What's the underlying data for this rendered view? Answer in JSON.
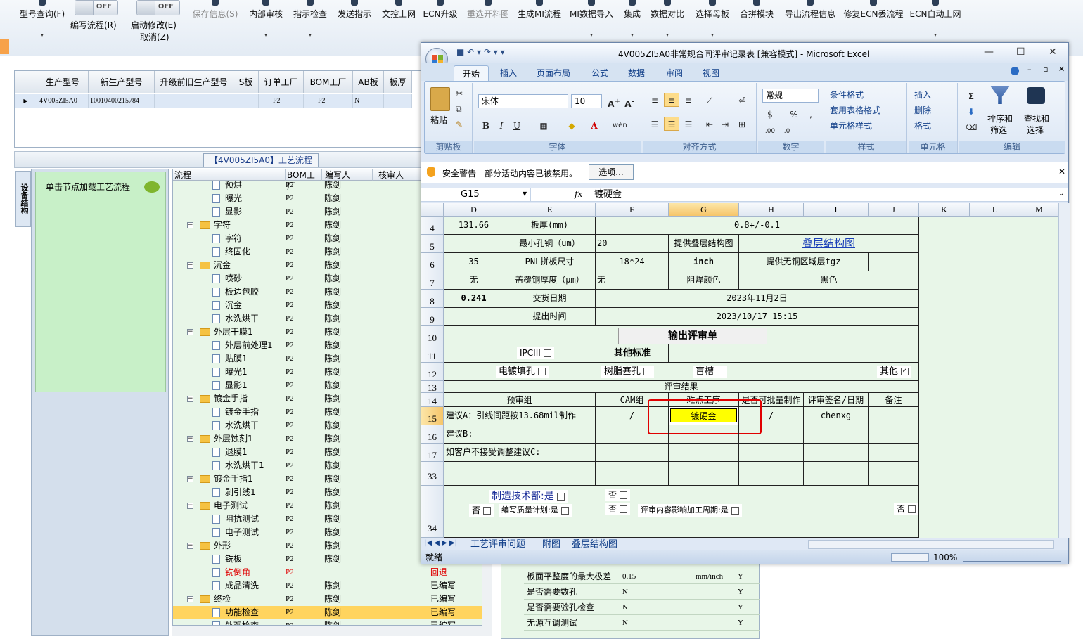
{
  "toolbar": {
    "items": [
      {
        "label": "型号查询(F)",
        "arrow": "▾"
      },
      {
        "label": "保存信息(S)",
        "disabled": true
      },
      {
        "label": "内部审核",
        "arrow": "▾"
      },
      {
        "label": "指示检查",
        "arrow": "▾"
      },
      {
        "label": "发送指示"
      },
      {
        "label": "文控上网"
      },
      {
        "label": "ECN升级"
      },
      {
        "label": "重选开料图",
        "disabled": true
      },
      {
        "label": "生成MI流程"
      },
      {
        "label": "MI数据导入",
        "arrow": "▾"
      },
      {
        "label": "集成",
        "arrow": "▾"
      },
      {
        "label": "数据对比",
        "arrow": "▾"
      },
      {
        "label": "选择母板",
        "arrow": "▾"
      },
      {
        "label": "合拼模块"
      },
      {
        "label": "导出流程信息"
      },
      {
        "label": "修复ECN丢流程"
      },
      {
        "label": "ECN自动上网",
        "arrow": "▾"
      }
    ],
    "toggle1": {
      "state": "OFF",
      "label": "编写流程(R)"
    },
    "toggle2": {
      "state": "OFF",
      "label": "启动修改(E)",
      "sub": "取消(Z)"
    }
  },
  "grid1": {
    "headers": [
      "生产型号",
      "新生产型号",
      "升级前旧生产型号",
      "S板",
      "订单工厂",
      "BOM工厂",
      "AB板",
      "板厚"
    ],
    "row": [
      "4V005ZI5A0",
      "10010400215784",
      "",
      "",
      "P2",
      "P2",
      "N",
      ""
    ]
  },
  "process": {
    "title": "【4V005ZI5A0】工艺流程",
    "side_tab": "设备结构",
    "load_hint": "单击节点加载工艺流程",
    "headers": [
      "流程",
      "BOM工厂",
      "编写人",
      "核审人"
    ],
    "rows": [
      {
        "name": "预烘",
        "bom": "P2",
        "author": "陈剑",
        "level": 2,
        "status": ""
      },
      {
        "name": "曝光",
        "bom": "P2",
        "author": "陈剑",
        "level": 2,
        "status": ""
      },
      {
        "name": "显影",
        "bom": "P2",
        "author": "陈剑",
        "level": 2,
        "status": ""
      },
      {
        "name": "字符",
        "bom": "P2",
        "author": "陈剑",
        "level": 1,
        "status": ""
      },
      {
        "name": "字符",
        "bom": "P2",
        "author": "陈剑",
        "level": 2,
        "status": ""
      },
      {
        "name": "终固化",
        "bom": "P2",
        "author": "陈剑",
        "level": 2,
        "status": ""
      },
      {
        "name": "沉金",
        "bom": "P2",
        "author": "陈剑",
        "level": 1,
        "status": ""
      },
      {
        "name": "喷砂",
        "bom": "P2",
        "author": "陈剑",
        "level": 2,
        "status": ""
      },
      {
        "name": "板边包胶",
        "bom": "P2",
        "author": "陈剑",
        "level": 2,
        "status": ""
      },
      {
        "name": "沉金",
        "bom": "P2",
        "author": "陈剑",
        "level": 2,
        "status": ""
      },
      {
        "name": "水洗烘干",
        "bom": "P2",
        "author": "陈剑",
        "level": 2,
        "status": ""
      },
      {
        "name": "外层干膜1",
        "bom": "P2",
        "author": "陈剑",
        "level": 1,
        "status": ""
      },
      {
        "name": "外层前处理1",
        "bom": "P2",
        "author": "陈剑",
        "level": 2,
        "status": ""
      },
      {
        "name": "贴膜1",
        "bom": "P2",
        "author": "陈剑",
        "level": 2,
        "status": ""
      },
      {
        "name": "曝光1",
        "bom": "P2",
        "author": "陈剑",
        "level": 2,
        "status": ""
      },
      {
        "name": "显影1",
        "bom": "P2",
        "author": "陈剑",
        "level": 2,
        "status": ""
      },
      {
        "name": "镀金手指",
        "bom": "P2",
        "author": "陈剑",
        "level": 1,
        "status": ""
      },
      {
        "name": "镀金手指",
        "bom": "P2",
        "author": "陈剑",
        "level": 2,
        "status": ""
      },
      {
        "name": "水洗烘干",
        "bom": "P2",
        "author": "陈剑",
        "level": 2,
        "status": ""
      },
      {
        "name": "外层蚀刻1",
        "bom": "P2",
        "author": "陈剑",
        "level": 1,
        "status": ""
      },
      {
        "name": "退膜1",
        "bom": "P2",
        "author": "陈剑",
        "level": 2,
        "status": ""
      },
      {
        "name": "水洗烘干1",
        "bom": "P2",
        "author": "陈剑",
        "level": 2,
        "status": ""
      },
      {
        "name": "镀金手指1",
        "bom": "P2",
        "author": "陈剑",
        "level": 1,
        "status": ""
      },
      {
        "name": "剥引线1",
        "bom": "P2",
        "author": "陈剑",
        "level": 2,
        "status": ""
      },
      {
        "name": "电子测试",
        "bom": "P2",
        "author": "陈剑",
        "level": 1,
        "status": ""
      },
      {
        "name": "阻抗测试",
        "bom": "P2",
        "author": "陈剑",
        "level": 2,
        "status": ""
      },
      {
        "name": "电子测试",
        "bom": "P2",
        "author": "陈剑",
        "level": 2,
        "status": ""
      },
      {
        "name": "外形",
        "bom": "P2",
        "author": "陈剑",
        "level": 1,
        "status": ""
      },
      {
        "name": "铣板",
        "bom": "P2",
        "author": "陈剑",
        "level": 2,
        "status": ""
      },
      {
        "name": "铣倒角",
        "bom": "P2",
        "author": "",
        "level": 2,
        "status": "回退",
        "red": true
      },
      {
        "name": "成品清洗",
        "bom": "P2",
        "author": "陈剑",
        "level": 2,
        "status": "已编写"
      },
      {
        "name": "终检",
        "bom": "P2",
        "author": "陈剑",
        "level": 1,
        "status": "已编写"
      },
      {
        "name": "功能检查",
        "bom": "P2",
        "author": "陈剑",
        "level": 2,
        "status": "已编写",
        "selected": true
      },
      {
        "name": "外观检查",
        "bom": "P2",
        "author": "陈剑",
        "level": 2,
        "status": "已编写"
      }
    ]
  },
  "grid2": {
    "rows": [
      [
        "板面平整度的最大极差",
        "0.15",
        "mm/inch",
        "Y"
      ],
      [
        "是否需要数孔",
        "N",
        "",
        "Y"
      ],
      [
        "是否需要验孔检查",
        "N",
        "",
        "Y"
      ],
      [
        "无源互调测试",
        "N",
        "",
        "Y"
      ]
    ]
  },
  "excel": {
    "title": "4V005ZI5A0非常规合同评审记录表 [兼容模式] - Microsoft Excel",
    "tabs": [
      "开始",
      "插入",
      "页面布局",
      "公式",
      "数据",
      "审阅",
      "视图"
    ],
    "ribbon": {
      "clipboard": {
        "paste": "粘贴",
        "group": "剪贴板"
      },
      "font": {
        "name": "宋体",
        "size": "10",
        "group": "字体"
      },
      "align": {
        "group": "对齐方式"
      },
      "number": {
        "format": "常规",
        "group": "数字"
      },
      "styles": {
        "cond": "条件格式",
        "table": "套用表格格式",
        "cell": "单元格样式",
        "group": "样式"
      },
      "cells": {
        "insert": "插入",
        "delete": "删除",
        "format": "格式",
        "group": "单元格"
      },
      "edit": {
        "sort": "排序和",
        "sort2": "筛选",
        "find": "查找和",
        "find2": "选择",
        "group": "编辑"
      }
    },
    "security": {
      "label": "安全警告",
      "msg": "部分活动内容已被禁用。",
      "button": "选项..."
    },
    "namebox": "G15",
    "formula": "镀硬金",
    "columns": [
      "D",
      "E",
      "F",
      "G",
      "H",
      "I",
      "J",
      "K",
      "L",
      "M"
    ],
    "active_col": "G",
    "rownums": [
      "4",
      "5",
      "6",
      "7",
      "8",
      "9",
      "10",
      "11",
      "12",
      "13",
      "14",
      "15",
      "16",
      "17",
      "33",
      "34"
    ],
    "active_row": "15",
    "cells": {
      "r4": {
        "d": "131.66",
        "e": "板厚(mm)",
        "fj": "0.8+/-0.1"
      },
      "r5": {
        "e": "最小孔铜（um）",
        "f": "20",
        "g": "提供叠层结构图",
        "hj": "叠层结构图"
      },
      "r6": {
        "d": "35",
        "e": "PNL拼板尺寸",
        "f": "18*24",
        "g": "inch",
        "hi": "提供无铜区域层tgz"
      },
      "r7": {
        "d": "无",
        "e": "盖覆铜厚度（μm）",
        "f": "无",
        "g": "阻焊颜色",
        "hj": "黑色"
      },
      "r8": {
        "d": "0.241",
        "e": "交货日期",
        "fj": "2023年11月2日"
      },
      "r9": {
        "e": "提出时间",
        "fj": "2023/10/17 15:15"
      },
      "r10": {
        "btn": "输出评审单"
      },
      "r11": {
        "ipc": "IPCIII",
        "other_std": "其他标准"
      },
      "r12": {
        "a": "电镀填孔",
        "b": "树脂塞孔",
        "c": "盲槽",
        "d": "其他"
      },
      "r13": {
        "title": "评审结果"
      },
      "r14": {
        "pre": "预审组",
        "cam": "CAM组",
        "hard": "难点工序",
        "batch": "是否可批量制作",
        "sign": "评审签名/日期",
        "note": "备注"
      },
      "r15": {
        "pre": "建议A：引线间距按13.68mil制作",
        "cam": "/",
        "hard": "镀硬金",
        "batch": "/",
        "sign": "chenxg"
      },
      "r16": {
        "pre": "建议B:"
      },
      "r17": {
        "pre": "如客户不接受调整建议C:"
      },
      "r34": {
        "mfg": "制造技术部:是",
        "no1": "否",
        "no2": "否",
        "q": "编写质量计划:是",
        "no3": "否",
        "cycle": "评审内容影响加工周期:是",
        "no4": "否"
      }
    },
    "sheet_tabs": [
      "工艺评审问题",
      "附图",
      "叠层结构图"
    ],
    "status": "就绪",
    "zoom": "100%"
  },
  "colors": {
    "accent": "#15428b",
    "cell_bg": "#e8f6e8",
    "highlight": "#ffff00",
    "outline": "#e00000"
  }
}
